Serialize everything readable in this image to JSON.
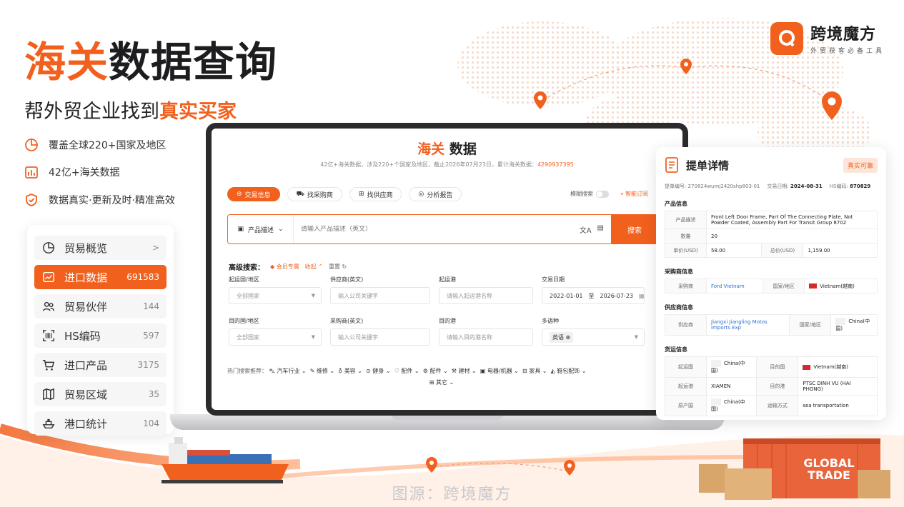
{
  "hero": {
    "title_a": "海关",
    "title_b": "数据查询",
    "subtitle_a": "帮外贸企业找到",
    "subtitle_b": "真实买家",
    "features": [
      "覆盖全球220+国家及地区",
      "42亿+海关数据",
      "数据真实·更新及时·精准高效"
    ]
  },
  "logo": {
    "name": "跨境魔方",
    "tagline": "外贸获客必备工具"
  },
  "sidebar": {
    "items": [
      {
        "label": "贸易概览",
        "count": ">",
        "icon": "pie-chart-icon"
      },
      {
        "label": "进口数据",
        "count": "691583",
        "icon": "line-chart-icon"
      },
      {
        "label": "贸易伙伴",
        "count": "144",
        "icon": "users-icon"
      },
      {
        "label": "HS编码",
        "count": "597",
        "icon": "scan-code-icon"
      },
      {
        "label": "进口产品",
        "count": "3175",
        "icon": "cart-icon"
      },
      {
        "label": "贸易区域",
        "count": "35",
        "icon": "map-icon"
      },
      {
        "label": "港口统计",
        "count": "104",
        "icon": "ship-icon"
      }
    ]
  },
  "app": {
    "title_a": "海关",
    "title_b": "数据",
    "desc": "42亿+海关数据，涉及220+个国家及地区，截止2026年07月23日，累计海关数据：",
    "desc_count": "4290937395",
    "tabs": [
      "交易信息",
      "找采购商",
      "找供应商",
      "分析报告"
    ],
    "fuzzy_label": "模糊搜索",
    "smart_label": "智能订阅",
    "search": {
      "dropdown": "产品描述",
      "placeholder": "请输入产品描述（英文）",
      "button": "搜索"
    },
    "advanced": {
      "label": "高级搜索：",
      "vip": "会员专属",
      "collapse": "收起",
      "reset": "重置"
    },
    "fields": {
      "origin_label": "起运国/地区",
      "origin_value": "全部国家",
      "supplier_label": "供应商(英文)",
      "supplier_ph": "输入公司关键字",
      "port_from_label": "起运港",
      "port_from_ph": "请输入起运港名称",
      "date_label": "交易日期",
      "date_from": "2022-01-01",
      "date_to_sep": "至",
      "date_to": "2026-07-23",
      "dest_label": "目的国/地区",
      "dest_value": "全部国家",
      "buyer_label": "采购商(英文)",
      "buyer_ph": "输入公司关键字",
      "port_to_label": "目的港",
      "port_to_ph": "请输入目的港名称",
      "lang_label": "多语种",
      "lang_value": "英语"
    },
    "hot": {
      "label": "热门搜索推荐：",
      "items": [
        "汽车行业",
        "维修",
        "美容",
        "健身",
        "配件",
        "配件",
        "建材",
        "电器/机器",
        "家具",
        "鞋包配饰",
        "其它"
      ]
    }
  },
  "receipt": {
    "title": "提单详情",
    "badge": "真实可靠",
    "meta": {
      "no_label": "提单编号:",
      "no": "270824wumj2420shp803-01",
      "date_label": "交易日期:",
      "date": "2024-08-31",
      "hs_label": "HS编码:",
      "hs": "870829"
    },
    "product_title": "产品信息",
    "product": {
      "desc_k": "产品描述",
      "desc_v": "Front Left Door Frame, Part Of The Connecting Plate, Not Powder Coated, Assembly Part For Transit Group 8702",
      "qty_k": "数量",
      "qty_v": "20",
      "unit_k": "单价(USD)",
      "unit_v": "58.00",
      "total_k": "总价(USD)",
      "total_v": "1,159.00"
    },
    "buyer_title": "采购商信息",
    "buyer": {
      "k": "采购商",
      "v": "Ford Vietnam",
      "country_k": "国家/地区",
      "country_v": "Vietnam(越南)"
    },
    "supplier_title": "供应商信息",
    "supplier": {
      "k": "供应商",
      "v": "Jiangxi Jiangling Motos Imports Exp",
      "country_k": "国家/地区",
      "country_v": "China(中国)"
    },
    "ship_title": "货运信息",
    "ship": {
      "from_k": "起运国",
      "from_v": "China(中国)",
      "to_k": "目的国",
      "to_v": "Vietnam(越南)",
      "pfrom_k": "起运港",
      "pfrom_v": "XIAMEN",
      "pto_k": "目的港",
      "pto_v": "PTSC DINH VU (HAI PHONG)",
      "origin_k": "原产国",
      "origin_v": "China(中国)",
      "mode_k": "运输方式",
      "mode_v": "sea transportation"
    }
  },
  "container_text": "GLOBAL TRADE",
  "credit": "图源：跨境魔方",
  "colors": {
    "accent": "#f2601e",
    "dark": "#1d1d1f"
  }
}
